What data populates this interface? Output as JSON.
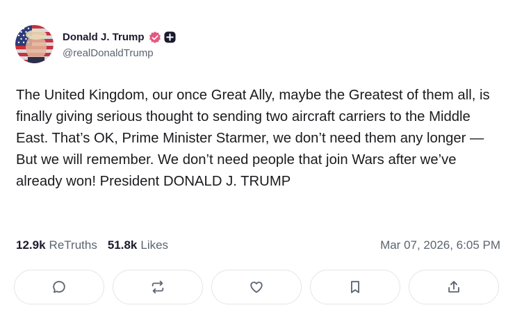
{
  "author": {
    "display_name": "Donald J. Trump",
    "handle": "@realDonaldTrump",
    "verified_color": "#e5577f"
  },
  "post": {
    "text": "The United Kingdom, our once Great Ally, maybe the Greatest of them all, is finally giving serious thought to sending two aircraft carriers to the Middle East. That’s OK, Prime Minister Starmer, we don’t need them any longer — But we will remember. We don’t need people that join Wars after we’ve already won! President DONALD J. TRUMP",
    "retruths_count": "12.9k",
    "retruths_label": "ReTruths",
    "likes_count": "51.8k",
    "likes_label": "Likes",
    "timestamp": "Mar 07, 2026, 6:05 PM"
  },
  "actions": [
    {
      "icon": "reply-icon"
    },
    {
      "icon": "retruth-icon"
    },
    {
      "icon": "heart-icon"
    },
    {
      "icon": "bookmark-icon"
    },
    {
      "icon": "share-icon"
    }
  ],
  "colors": {
    "text": "#1b1b1f",
    "muted": "#5b6470",
    "border": "#e3e5e8"
  }
}
